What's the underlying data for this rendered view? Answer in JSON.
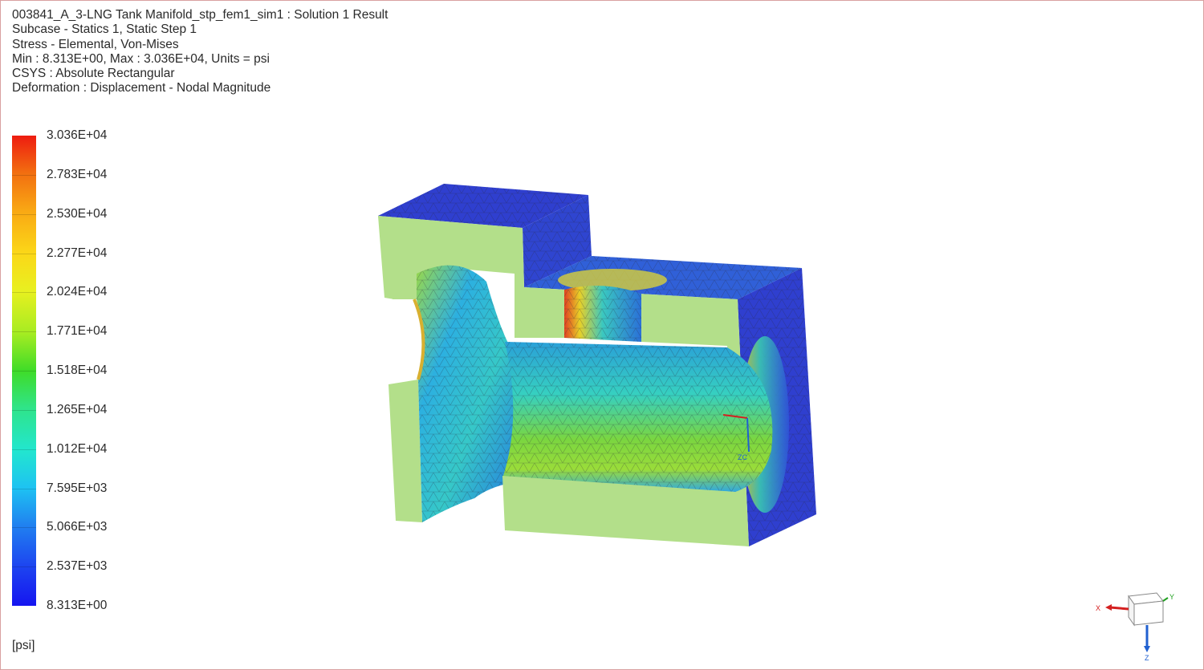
{
  "header": {
    "line1": "003841_A_3-LNG Tank Manifold_stp_fem1_sim1 : Solution 1 Result",
    "line2": "Subcase - Statics 1, Static Step 1",
    "line3": "Stress - Elemental, Von-Mises",
    "line4": "Min : 8.313E+00, Max : 3.036E+04, Units = psi",
    "line5": "CSYS : Absolute Rectangular",
    "line6": "Deformation : Displacement - Nodal Magnitude"
  },
  "legend": {
    "labels": [
      "3.036E+04",
      "2.783E+04",
      "2.530E+04",
      "2.277E+04",
      "2.024E+04",
      "1.771E+04",
      "1.518E+04",
      "1.265E+04",
      "1.012E+04",
      "7.595E+03",
      "5.066E+03",
      "2.537E+03",
      "8.313E+00"
    ],
    "units": "[psi]",
    "colors": {
      "max": "#ee1c10",
      "min": "#1515f0"
    }
  },
  "model": {
    "wcs_label": "ZC",
    "colors": {
      "cut_face": "#b3df8a",
      "low_stress": "#2f3fcf",
      "mid_stress": "#3fd0b0",
      "high_stress": "#e8d020"
    }
  },
  "triad": {
    "x_label": "X",
    "y_label": "Y",
    "z_label": "Z",
    "colors": {
      "x": "#d42020",
      "y": "#20a020",
      "z": "#2060d0"
    }
  }
}
